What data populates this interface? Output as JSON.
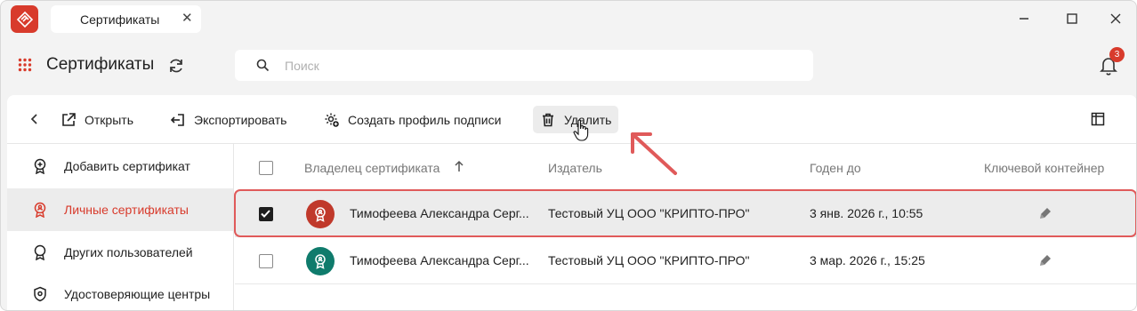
{
  "window": {
    "tab_title": "Сертификаты",
    "tab_close_icon": "close-icon",
    "controls": [
      "minimize-icon",
      "maximize-icon",
      "close-icon"
    ]
  },
  "header": {
    "title": "Сертификаты",
    "search_placeholder": "Поиск",
    "search_value": "",
    "notifications_count": "3"
  },
  "toolbar": {
    "open_label": "Открыть",
    "export_label": "Экспортировать",
    "create_profile_label": "Создать профиль подписи",
    "delete_label": "Удалить"
  },
  "sidebar": {
    "items": [
      {
        "label": "Добавить сертификат",
        "icon": "certificate-add-icon",
        "active": false
      },
      {
        "label": "Личные сертификаты",
        "icon": "personal-certificate-icon",
        "active": true
      },
      {
        "label": "Других пользователей",
        "icon": "certificate-icon",
        "active": false
      },
      {
        "label": "Удостоверяющие центры",
        "icon": "shield-icon",
        "active": false
      }
    ]
  },
  "table": {
    "columns": {
      "owner": "Владелец сертификата",
      "issuer": "Издатель",
      "valid_until": "Годен до",
      "key_container": "Ключевой контейнер"
    },
    "sort_icon": "arrow-up-icon",
    "rows": [
      {
        "checked": true,
        "avatar_color": "#c0392b",
        "owner": "Тимофеева Александра Серг...",
        "issuer": "Тестовый УЦ ООО \"КРИПТО-ПРО\"",
        "valid_until": "3 янв. 2026 г., 10:55",
        "key_icon": "usb-key-icon"
      },
      {
        "checked": false,
        "avatar_color": "#0f7b6c",
        "owner": "Тимофеева Александра Серг...",
        "issuer": "Тестовый УЦ ООО \"КРИПТО-ПРО\"",
        "valid_until": "3 мар. 2026 г., 15:25",
        "key_icon": "usb-key-icon"
      }
    ]
  },
  "colors": {
    "accent": "#d83b2c",
    "annotation": "#e05a5a",
    "selected_row": "#ececec"
  }
}
